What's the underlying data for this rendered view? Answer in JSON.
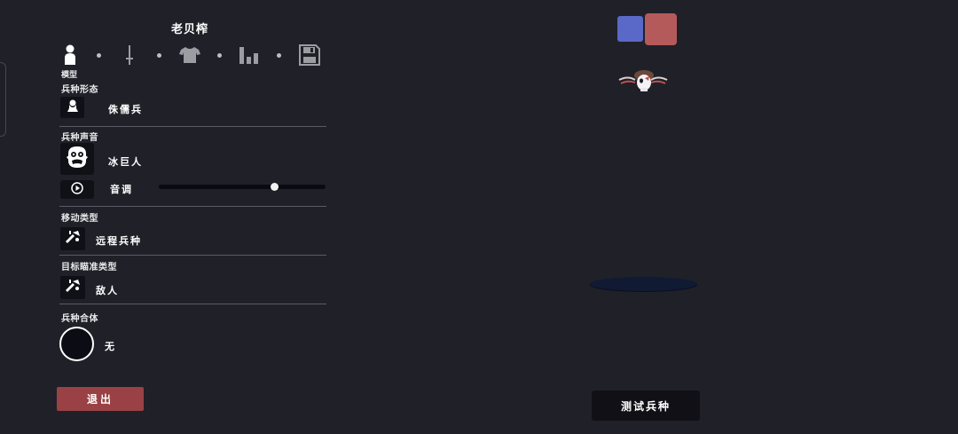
{
  "unit": {
    "name": "老贝榨"
  },
  "tabs": {
    "active_label": "模型",
    "items": [
      {
        "icon": "person-icon"
      },
      {
        "icon": "sword-icon"
      },
      {
        "icon": "shirt-icon"
      },
      {
        "icon": "stats-icon"
      },
      {
        "icon": "save-icon"
      }
    ]
  },
  "sections": {
    "form": {
      "label": "兵种形态",
      "value": "侏儒兵",
      "icon": "dwarf-icon"
    },
    "voice": {
      "label": "兵种声音",
      "value": "冰巨人",
      "icon": "ice-giant-face-icon",
      "pitch_label": "音调",
      "pitch_fraction": 0.69
    },
    "movement": {
      "label": "移动类型",
      "value": "远程兵种",
      "icon": "ranged-icon"
    },
    "targeting": {
      "label": "目标瞄准类型",
      "value": "敌人",
      "icon": "target-icon"
    },
    "fusion": {
      "label": "兵种合体",
      "value": "无"
    }
  },
  "buttons": {
    "exit": "退出",
    "test": "测试兵种"
  },
  "colors": {
    "background": "#202028",
    "team_blue": "#5a68c7",
    "team_red": "#b55a5a",
    "exit_button": "#994145",
    "platform": "#101a33"
  }
}
